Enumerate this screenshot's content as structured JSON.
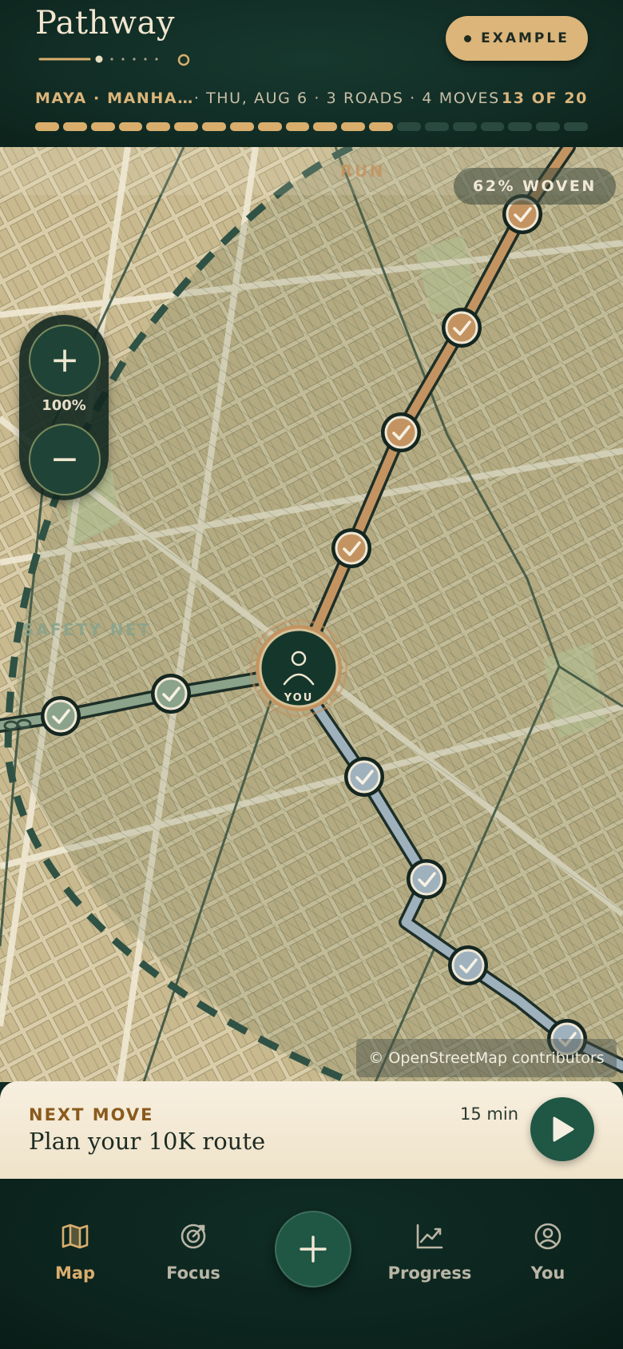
{
  "header": {
    "app_title": "Pathway",
    "example_label": "EXAMPLE",
    "meta_who": "MAYA · MANHA…",
    "meta_rest": " · THU, AUG 6 · 3 ROADS · 4 MOVES",
    "step_count": "13 OF 20",
    "progress": {
      "done": 13,
      "total": 20
    }
  },
  "map": {
    "zoom_in_label": "+",
    "zoom_out_label": "−",
    "zoom_level": "100%",
    "woven_label": "62% WOVEN",
    "attribution": "© OpenStreetMap contributors",
    "zone_labels": {
      "run": "RUN",
      "safety_net": "SAFETY NET"
    },
    "you_label": "YOU",
    "roads": [
      {
        "name": "run",
        "color": "#c39461",
        "checkpoints_done": 4
      },
      {
        "name": "safety-net",
        "color": "#8ba38a",
        "checkpoints_done": 2
      },
      {
        "name": "third-road",
        "color": "#9eb1bd",
        "checkpoints_done": 4
      }
    ]
  },
  "next_move": {
    "label": "NEXT MOVE",
    "title": "Plan your 10K route",
    "duration": "15 min"
  },
  "nav": {
    "items": [
      {
        "label": "Map",
        "icon": "map-icon",
        "active": true
      },
      {
        "label": "Focus",
        "icon": "target-icon",
        "active": false
      },
      {
        "label": "Progress",
        "icon": "chart-icon",
        "active": false
      },
      {
        "label": "You",
        "icon": "user-icon",
        "active": false
      }
    ],
    "add_icon": "plus-icon"
  },
  "colors": {
    "accent_gold": "#dcb57a",
    "dark_green": "#112d25",
    "cream": "#f7efdf"
  }
}
